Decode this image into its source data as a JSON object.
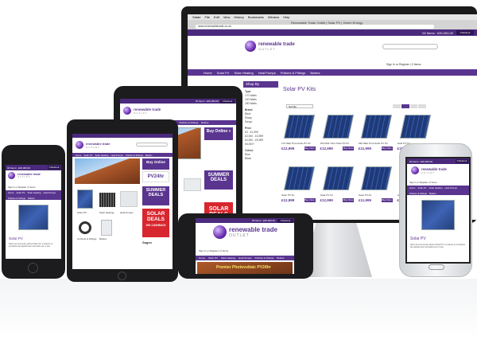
{
  "desktop": {
    "window_title": "Renewable Trade Outlet | Solar PV | Green Energy",
    "url": "www.renewabletrade.co.uk",
    "menu": [
      "Safari",
      "File",
      "Edit",
      "View",
      "History",
      "Bookmarks",
      "Window",
      "Help"
    ],
    "basket": "00 Items : £00,000.00",
    "checkout": "Checkout",
    "logo_main": "renewable trade",
    "logo_sub": "OUTLET",
    "login_text": "Sign In or Register | 0 Items",
    "nav": [
      "Home",
      "Solar PV",
      "Solar Heating",
      "Heat Pumps",
      "Policies & Fittings",
      "Boilers"
    ],
    "sidebar_title": "Shop By",
    "sidebar_groups": [
      {
        "label": "Type",
        "items": [
          "170 Watts",
          "240 Watts",
          "250 Watts"
        ]
      },
      {
        "label": "Brand",
        "items": [
          "Bisol",
          "Sharp",
          "Sanyo"
        ]
      },
      {
        "label": "Price",
        "items": [
          "£0 - £1,999",
          "£2,000 - £3,999",
          "£4,000 - £5,999",
          "£6,000+"
        ]
      },
      {
        "label": "Colour",
        "items": [
          "Blue",
          "Black"
        ]
      }
    ],
    "page_heading": "Solar PV Kits",
    "sort_label": "Sort By",
    "products": [
      {
        "name": "170 Watt Trina Solar PV Kit",
        "price": "£12,999"
      },
      {
        "name": "250 Watt Trina Solar PV Kit",
        "price": "£12,999"
      },
      {
        "name": "250 Watt Trina Solar PV Kit",
        "price": "£11,999"
      },
      {
        "name": "Solar PV Kit",
        "price": "£15,999"
      },
      {
        "name": "Solar PV Kit",
        "price": "£12,999"
      },
      {
        "name": "Solar PV Kit",
        "price": "£12,999"
      },
      {
        "name": "Solar PV Kit",
        "price": "£11,999"
      },
      {
        "name": "Solar PV Kit",
        "price": "£12,999"
      }
    ],
    "buy_now": "Buy Now"
  },
  "tablet": {
    "basket": "00 Items : £00,000.00",
    "checkout": "Checkout",
    "logo_main": "renewable trade",
    "logo_sub": "OUTLET",
    "nav": [
      "Home",
      "Solar PV",
      "Solar Heating",
      "Heat Pumps",
      "Policies & Fittings",
      "Boilers"
    ],
    "buy_online": "Buy Online »",
    "promo": "PV24hr",
    "summer": "SUMMER DEALS",
    "solar_deals": "SOLAR DEALS",
    "cashback": "15% CASHBACK"
  },
  "ipad_mini": {
    "logo_main": "renewable trade",
    "logo_sub": "OUTLET",
    "nav": [
      "Home",
      "Solar PV",
      "Solar Heating",
      "Heat Pumps",
      "Policies & Fittings",
      "Boilers"
    ],
    "buy_online": "Buy Online",
    "promo": "PV24hr",
    "summer": "SUMMER DEALS",
    "solar_deals": "SOLAR DEALS",
    "cashback": "15% CASHBACK",
    "products": [
      "Solar PV",
      "Solar Heating",
      "Heat Pumps",
      "Controls & Fittings",
      "Boilers"
    ],
    "sagen": "Sagen"
  },
  "iphone_left": {
    "basket": "00 Items : £00,000.00",
    "checkout": "Checkout",
    "logo_main": "renewable trade",
    "logo_sub": "OUTLET",
    "login": "Sign In or Register | 0 Items",
    "nav": [
      "Home",
      "Solar PV",
      "Solar Heating",
      "Heat Pumps",
      "Policies & Fittings",
      "Boilers"
    ],
    "heading": "Solar PV",
    "blurb": "Short text summary about Solar PV. A chance to introduce the department and add one or two"
  },
  "iphone_landscape": {
    "basket": "00 Items : £00,000.00",
    "checkout": "Checkout",
    "logo_main": "renewable trade",
    "logo_sub": "OUTLET",
    "login": "Sign In or Register | 0 Items",
    "nav": [
      "Home",
      "Solar PV",
      "Solar Heating",
      "Heat Pumps",
      "Policies & Fittings",
      "Boilers"
    ],
    "promo": "Premier Photovoltaic PV24hr"
  },
  "android": {
    "basket": "00 Items : £00,000.00",
    "checkout": "Checkout",
    "logo_main": "renewable trade",
    "logo_sub": "OUTLET",
    "login": "Sign In or Register | 0 Items",
    "nav": [
      "Home",
      "Solar PV",
      "Solar Heating",
      "Heat Pumps",
      "Policies & Fittings",
      "Boilers"
    ],
    "heading": "Solar PV",
    "blurb": "Short text summary about Solar PV. A chance to introduce the department and add one or two"
  },
  "colors": {
    "brand": "#5a3590",
    "red": "#d8262e",
    "solar": "#2f4f96"
  }
}
